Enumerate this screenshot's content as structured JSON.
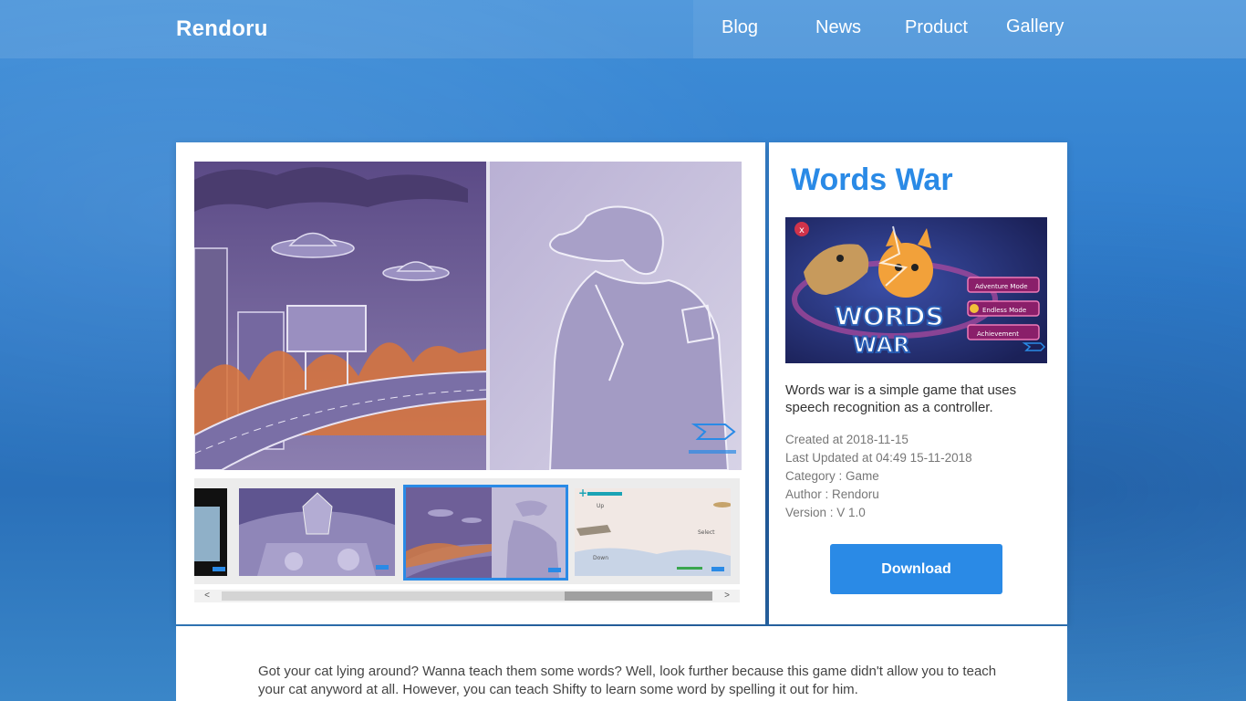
{
  "header": {
    "logo": "Rendoru",
    "nav": [
      {
        "label": "Blog"
      },
      {
        "label": "News"
      },
      {
        "label": "Product"
      },
      {
        "label": "Gallery"
      }
    ]
  },
  "product": {
    "title": "Words War",
    "description": "Words war is a simple game that uses speech recognition as a controller.",
    "meta": {
      "created": "Created at 2018-11-15",
      "updated": "Last Updated at 04:49 15-11-2018",
      "category": "Category : Game",
      "author": "Author : Rendoru",
      "version": "Version : V 1.0"
    },
    "download_label": "Download",
    "banner_text": {
      "logo_line1": "WORDS",
      "logo_line2": "WAR",
      "menu": [
        "Adventure Mode",
        "Endless Mode",
        "Achievement"
      ],
      "close": "x"
    }
  },
  "gallery": {
    "thumb_labels": {
      "up": "Up",
      "down": "Down",
      "select": "Select"
    },
    "scroll_left": "<",
    "scroll_right": ">"
  },
  "footer": {
    "text": "Got your cat lying around? Wanna teach them some words? Well, look further because this game didn't allow you to teach your cat anyword at all. However, you can teach Shifty to learn some word by spelling it out for him."
  },
  "colors": {
    "accent": "#2a8ae6",
    "background": "#2f7ccb"
  }
}
